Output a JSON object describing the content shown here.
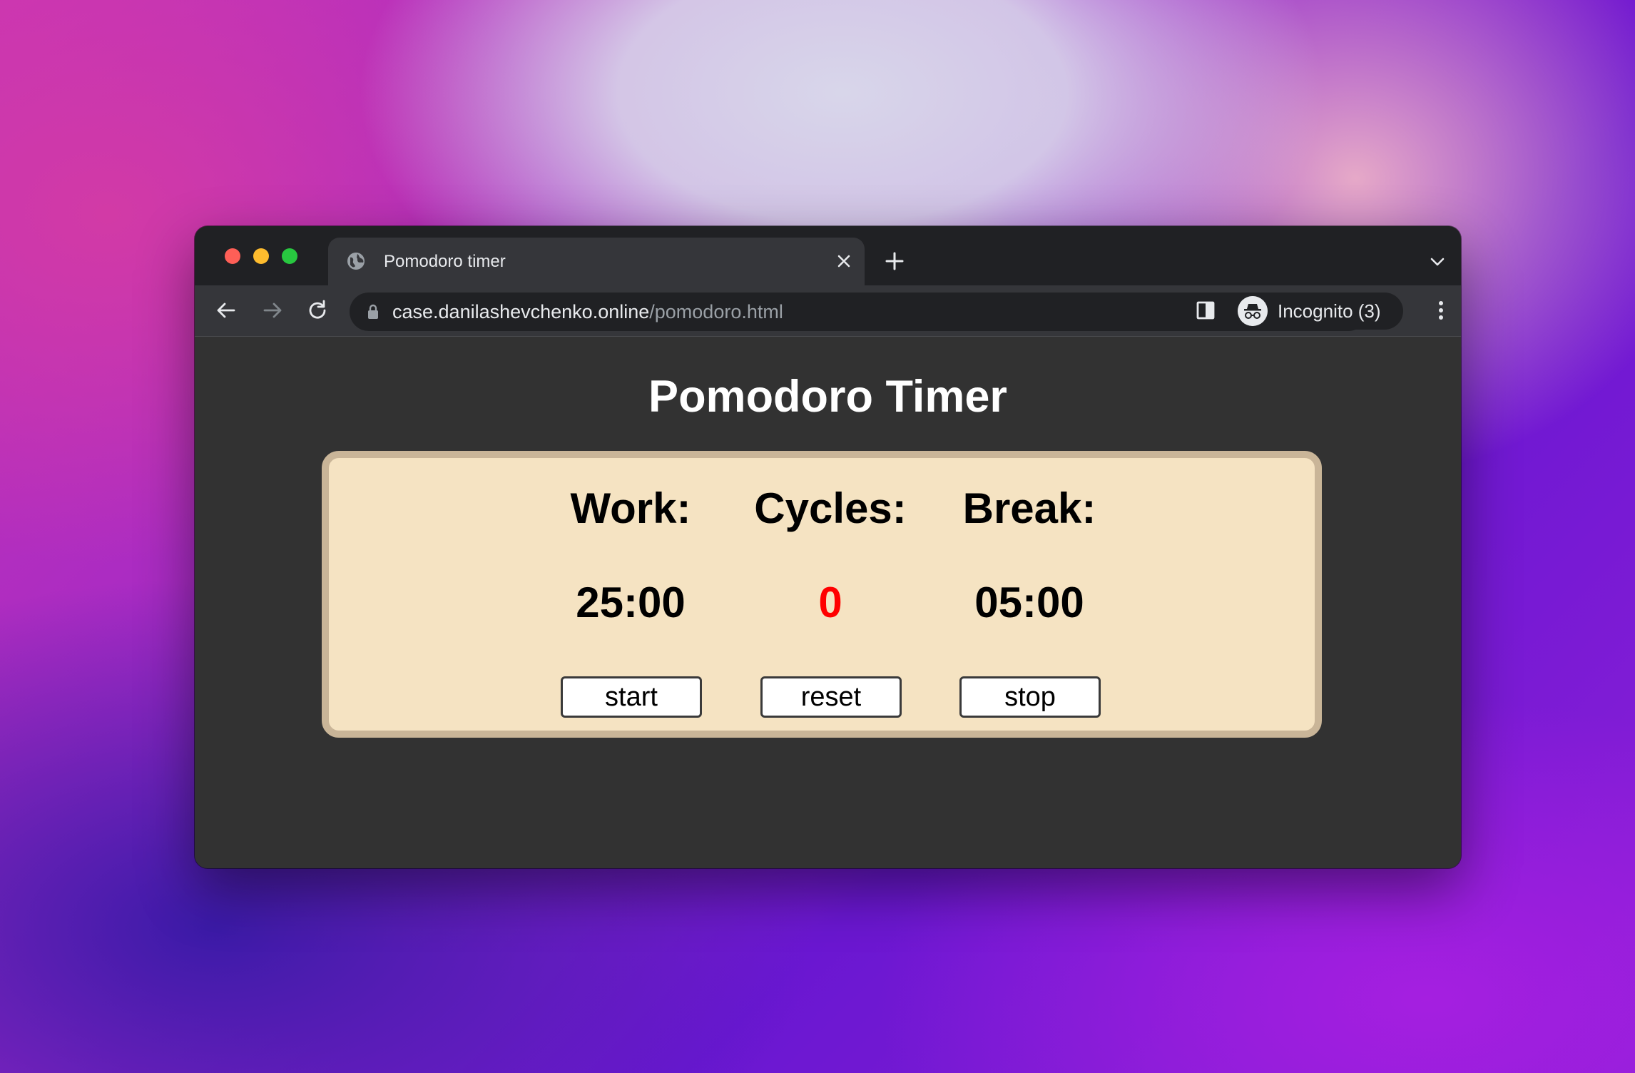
{
  "browser": {
    "tab": {
      "title": "Pomodoro timer"
    },
    "address_bar": {
      "host": "case.danilashevchenko.online",
      "path": "/pomodoro.html"
    },
    "profile": {
      "label": "Incognito (3)"
    },
    "colors": {
      "frame": "#202124",
      "toolbar": "#35363a",
      "close": "#fe5f57",
      "minimize": "#febc2e",
      "zoom": "#28c840"
    }
  },
  "page": {
    "title": "Pomodoro Timer",
    "background": "#323232",
    "panel_color": "#f5e3c2",
    "panel_border": "#c9b598",
    "columns": [
      {
        "label": "Work:",
        "value": "25:00",
        "button": "start"
      },
      {
        "label": "Cycles:",
        "value": "0",
        "value_color": "#ff0000",
        "button": "reset"
      },
      {
        "label": "Break:",
        "value": "05:00",
        "button": "stop"
      }
    ]
  }
}
